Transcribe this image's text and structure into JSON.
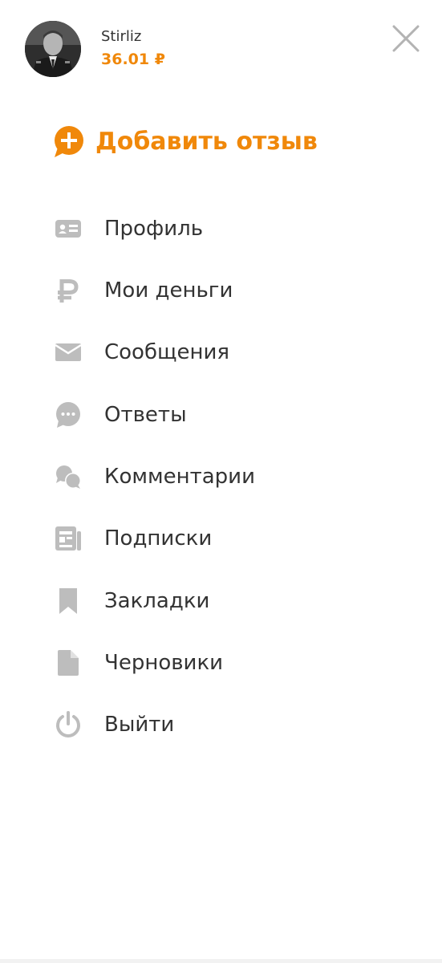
{
  "user": {
    "name": "Stirliz",
    "balance": "36.01 ₽"
  },
  "actions": {
    "add_review": "Добавить отзыв"
  },
  "menu": {
    "items": [
      {
        "label": "Профиль",
        "icon": "profile-card-icon"
      },
      {
        "label": "Мои деньги",
        "icon": "ruble-icon"
      },
      {
        "label": "Сообщения",
        "icon": "envelope-icon"
      },
      {
        "label": "Ответы",
        "icon": "chat-bubble-icon"
      },
      {
        "label": "Комментарии",
        "icon": "comments-icon"
      },
      {
        "label": "Подписки",
        "icon": "subscriptions-icon"
      },
      {
        "label": "Закладки",
        "icon": "bookmark-icon"
      },
      {
        "label": "Черновики",
        "icon": "draft-document-icon"
      },
      {
        "label": "Выйти",
        "icon": "power-icon"
      }
    ]
  },
  "colors": {
    "accent": "#f0880a",
    "text": "#333333",
    "icon": "#bdbdbd"
  }
}
